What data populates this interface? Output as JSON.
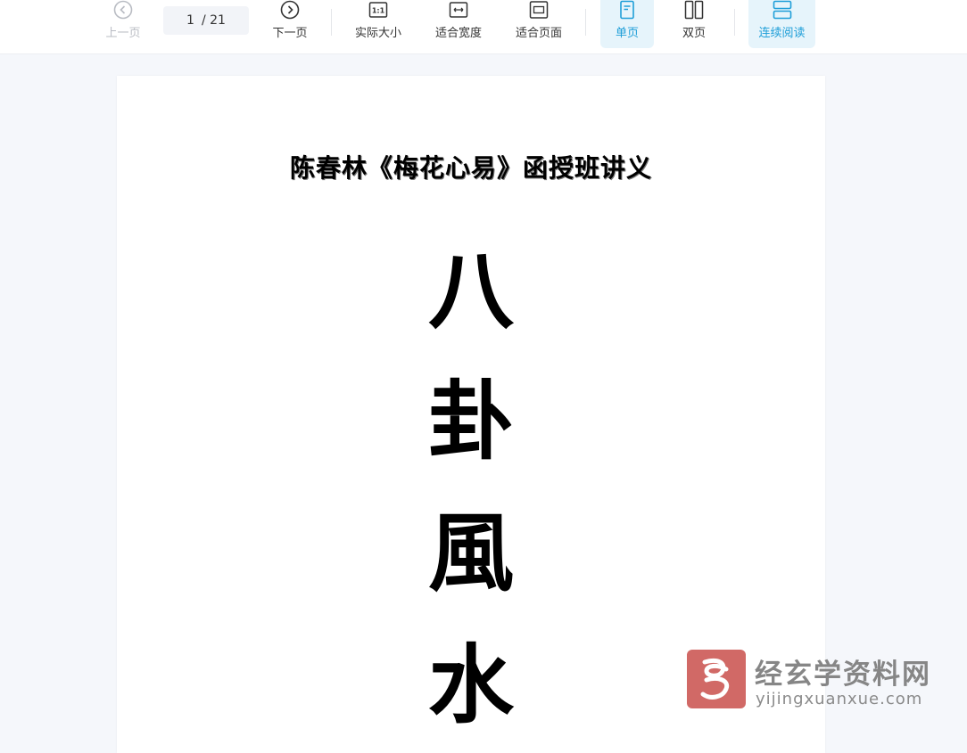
{
  "toolbar": {
    "prev_label": "上一页",
    "current_page": "1",
    "total_pages": "/ 21",
    "next_label": "下一页",
    "actual_size_label": "实际大小",
    "fit_width_label": "适合宽度",
    "fit_page_label": "适合页面",
    "single_page_label": "单页",
    "double_page_label": "双页",
    "continuous_label": "连续阅读",
    "actual_size_icon_text": "1:1"
  },
  "icons": {
    "prev": "chevron-left-circle-icon",
    "next": "chevron-right-circle-icon",
    "actual_size": "actual-size-icon",
    "fit_width": "fit-width-icon",
    "fit_page": "fit-page-icon",
    "single_page": "single-page-icon",
    "double_page": "double-page-icon",
    "continuous": "continuous-icon"
  },
  "colors": {
    "accent": "#1e9ed8",
    "active_bg": "#e6f4fb",
    "disabled": "#b9bcc3",
    "watermark_red": "#c9504c"
  },
  "document": {
    "title": "陈春林《梅花心易》函授班讲义",
    "vertical_chars": [
      "八",
      "卦",
      "風",
      "水"
    ]
  },
  "watermark": {
    "name": "经玄学资料网",
    "url": "yijingxuanxue.com"
  }
}
